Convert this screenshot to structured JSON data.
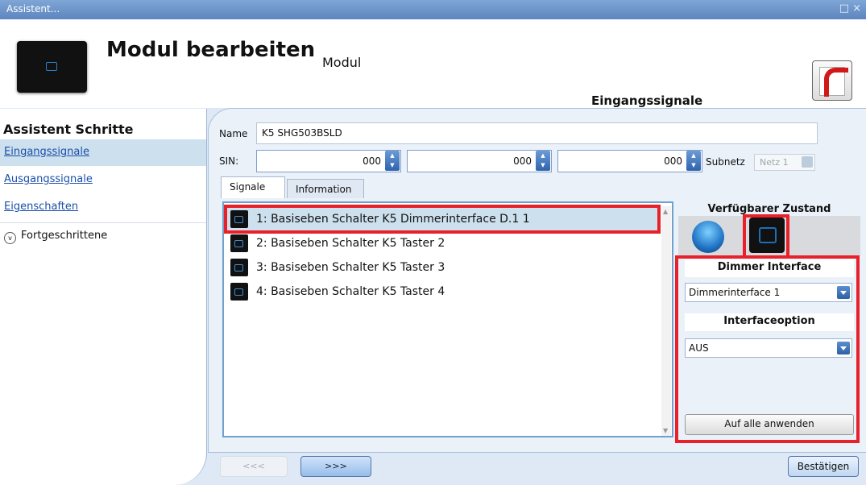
{
  "window": {
    "title": "Assistent...",
    "controls": "□ ×"
  },
  "header": {
    "title": "Modul bearbeiten",
    "subtitle": "Modul",
    "active_step": "Eingangssignale",
    "pdf_icon": "pdf-icon"
  },
  "sidebar": {
    "title": "Assistent Schritte",
    "items": [
      {
        "label": "Eingangssignale"
      },
      {
        "label": "Ausgangssignale"
      },
      {
        "label": "Eigenschaften"
      }
    ],
    "advanced": "Fortgeschrittene",
    "advanced_chevron": "v"
  },
  "form": {
    "name_label": "Name",
    "name_value": "K5 SHG503BSLD",
    "sin_label": "SIN:",
    "sin_values": [
      "000",
      "000",
      "000"
    ],
    "subnet_label": "Subnetz",
    "subnet_value": "Netz 1"
  },
  "tabs": [
    {
      "label": "Signale"
    },
    {
      "label": "Information"
    }
  ],
  "signals": [
    {
      "label": "1: Basiseben Schalter K5 Dimmerinterface D.1 1"
    },
    {
      "label": "2: Basiseben Schalter K5 Taster 2"
    },
    {
      "label": "3: Basiseben Schalter K5 Taster 3"
    },
    {
      "label": "4: Basiseben Schalter K5 Taster 4"
    }
  ],
  "right_panel": {
    "available_state_title": "Verfügbarer Zustand",
    "dimmer_section": "Dimmer Interface",
    "dimmer_value": "Dimmerinterface 1",
    "option_section": "Interfaceoption",
    "option_value": "AUS",
    "apply_button": "Auf alle anwenden"
  },
  "footer": {
    "prev": "<<<",
    "next": ">>>",
    "confirm": "Bestätigen"
  },
  "colors": {
    "highlight": "#e8202a",
    "title_bar": "#6b93ca",
    "selection": "#cde0ee"
  }
}
